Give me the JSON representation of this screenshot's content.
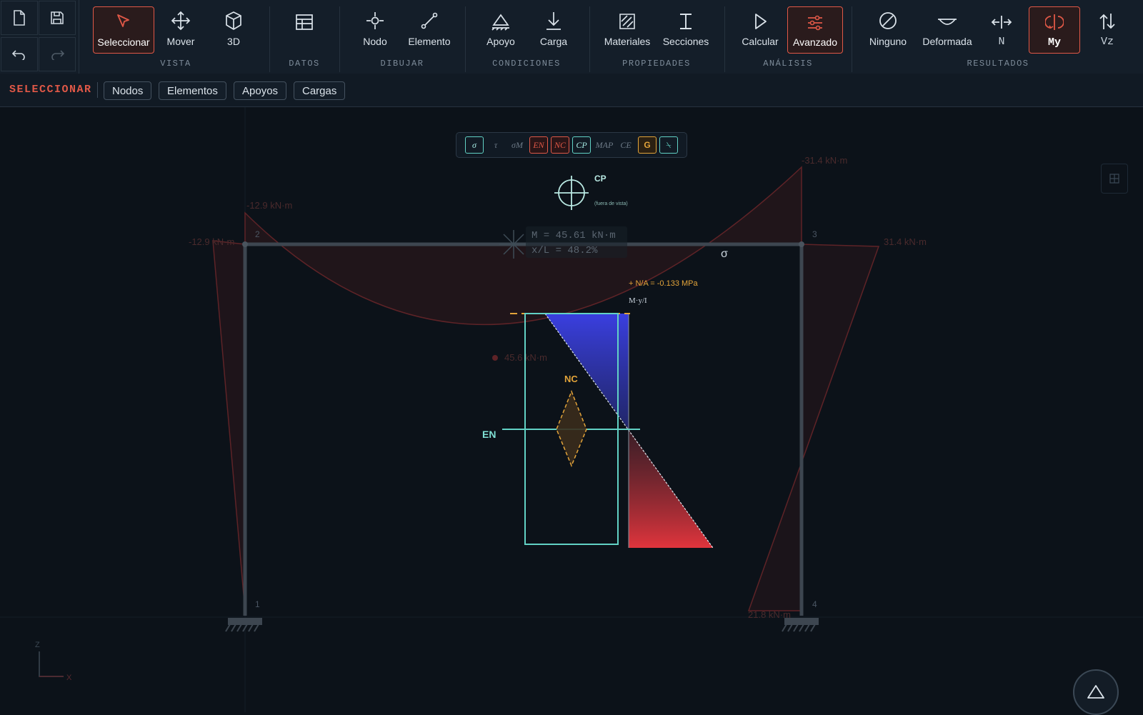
{
  "toolbar": {
    "groups": {
      "vista": "VISTA",
      "datos": "DATOS",
      "dibujar": "DIBUJAR",
      "condiciones": "CONDICIONES",
      "propiedades": "PROPIEDADES",
      "analisis": "ANÁLISIS",
      "resultados": "RESULTADOS"
    },
    "tools": {
      "seleccionar": "Seleccionar",
      "mover": "Mover",
      "3d": "3D",
      "datos": "",
      "nodo": "Nodo",
      "elemento": "Elemento",
      "apoyo": "Apoyo",
      "carga": "Carga",
      "materiales": "Materiales",
      "secciones": "Secciones",
      "calcular": "Calcular",
      "avanzado": "Avanzado",
      "ninguno": "Ninguno",
      "deformada": "Deformada",
      "n": "N",
      "my": "My",
      "vz": "Vz"
    },
    "active_tools": [
      "Seleccionar",
      "Avanzado",
      "My"
    ],
    "accent_color": "#e05847"
  },
  "subbar": {
    "title": "SELECCIONAR",
    "chips": [
      "Nodos",
      "Elementos",
      "Apoyos",
      "Cargas"
    ]
  },
  "stress_panel": {
    "buttons": [
      "σ",
      "τ",
      "σM",
      "EN",
      "NC",
      "CP",
      "MAP",
      "CE",
      "G",
      "⍀"
    ]
  },
  "frame": {
    "nodes": [
      "1",
      "2",
      "3",
      "4"
    ],
    "moment_labels": {
      "node2_top": "-12.9 kN·m",
      "node2_left": "-12.9 kN·m",
      "node3_top": "-31.4 kN·m",
      "node3_right": "31.4 kN·m",
      "midspan": "45.6 kN·m",
      "node4_base": "21.8 kN·m"
    }
  },
  "readout": {
    "m": "M = 45.61 kN·m",
    "xl": "x/L = 48.2%"
  },
  "section_overlay": {
    "cp_label": "CP",
    "cp_sub": "(fuera de vista)",
    "sigma_label": "σ",
    "na_label": "+ N/A = -0.133 MPa",
    "formula": "M·y/I",
    "nc_label": "NC",
    "en_label": "EN",
    "colors": {
      "compression": "#3a3fe0",
      "tension": "#e0343c",
      "section": "#62d2c5",
      "core": "#e3a43a"
    }
  },
  "axes": {
    "z": "Z",
    "x": "X"
  }
}
